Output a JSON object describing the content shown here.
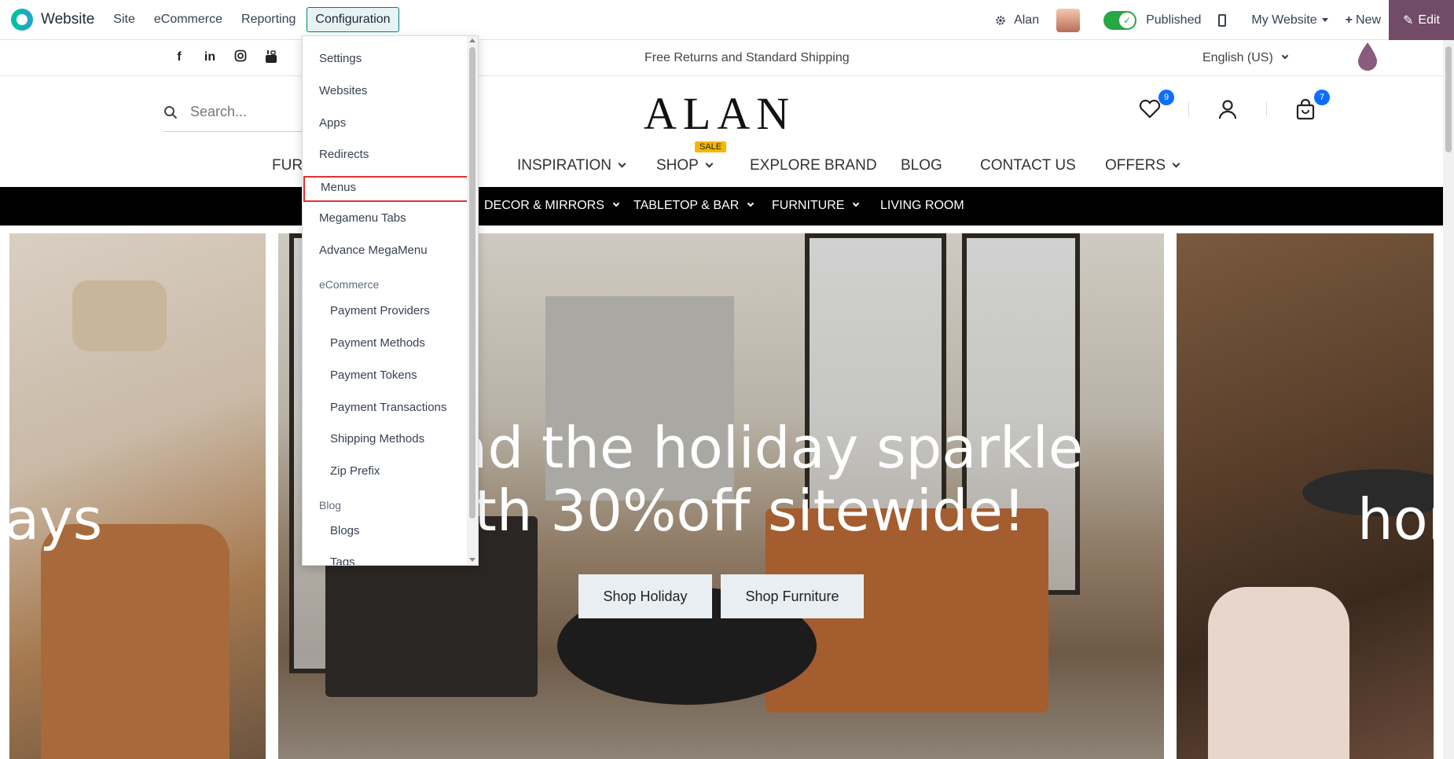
{
  "odoo_bar": {
    "brand": "Website",
    "menu": [
      "Site",
      "eCommerce",
      "Reporting",
      "Configuration"
    ],
    "active_menu": "Configuration",
    "user": "Alan",
    "published_label": "Published",
    "website_selector": "My Website",
    "new_label": "New",
    "edit_label": "Edit"
  },
  "announcement": {
    "text": "Free Returns and Standard Shipping",
    "language": "English (US)",
    "social_icons": [
      "facebook-icon",
      "linkedin-icon",
      "instagram-icon",
      "youtube-icon"
    ]
  },
  "header": {
    "search_placeholder": "Search...",
    "logo": "ALAN",
    "wishlist_count": "9",
    "cart_count": "7"
  },
  "main_nav": {
    "items": [
      {
        "label": "FURN",
        "has_caret": false
      },
      {
        "label": "INSPIRATION",
        "has_caret": true
      },
      {
        "label": "SHOP",
        "has_caret": true
      },
      {
        "label": "EXPLORE BRAND",
        "has_caret": false
      },
      {
        "label": "BLOG",
        "has_caret": false
      },
      {
        "label": "CONTACT US",
        "has_caret": false
      },
      {
        "label": "OFFERS",
        "has_caret": true
      }
    ],
    "sale_badge": "SALE"
  },
  "category_bar": {
    "items": [
      "DECOR & MIRRORS",
      "TABLETOP & BAR",
      "FURNITURE",
      "LIVING ROOM"
    ]
  },
  "hero": {
    "left_text": "ays",
    "line1": "read the holiday sparkle",
    "line2": "With 30%off sitewide!",
    "right_text": "hon",
    "button1": "Shop Holiday",
    "button2": "Shop Furniture"
  },
  "dropdown": {
    "items": [
      "Settings",
      "Websites",
      "Apps",
      "Redirects",
      "Menus",
      "Megamenu Tabs",
      "Advance MegaMenu"
    ],
    "highlighted": "Menus",
    "ecommerce_header": "eCommerce",
    "ecommerce_items": [
      "Payment Providers",
      "Payment Methods",
      "Payment Tokens",
      "Payment Transactions",
      "Shipping Methods",
      "Zip Prefix"
    ],
    "blog_header": "Blog",
    "blog_items": [
      "Blogs",
      "Tags"
    ]
  },
  "colors": {
    "odoo_purple": "#714b67",
    "highlight_red": "#e03131",
    "published_green": "#28a745",
    "badge_blue": "#0d6efd",
    "sale_yellow": "#f5b800"
  }
}
